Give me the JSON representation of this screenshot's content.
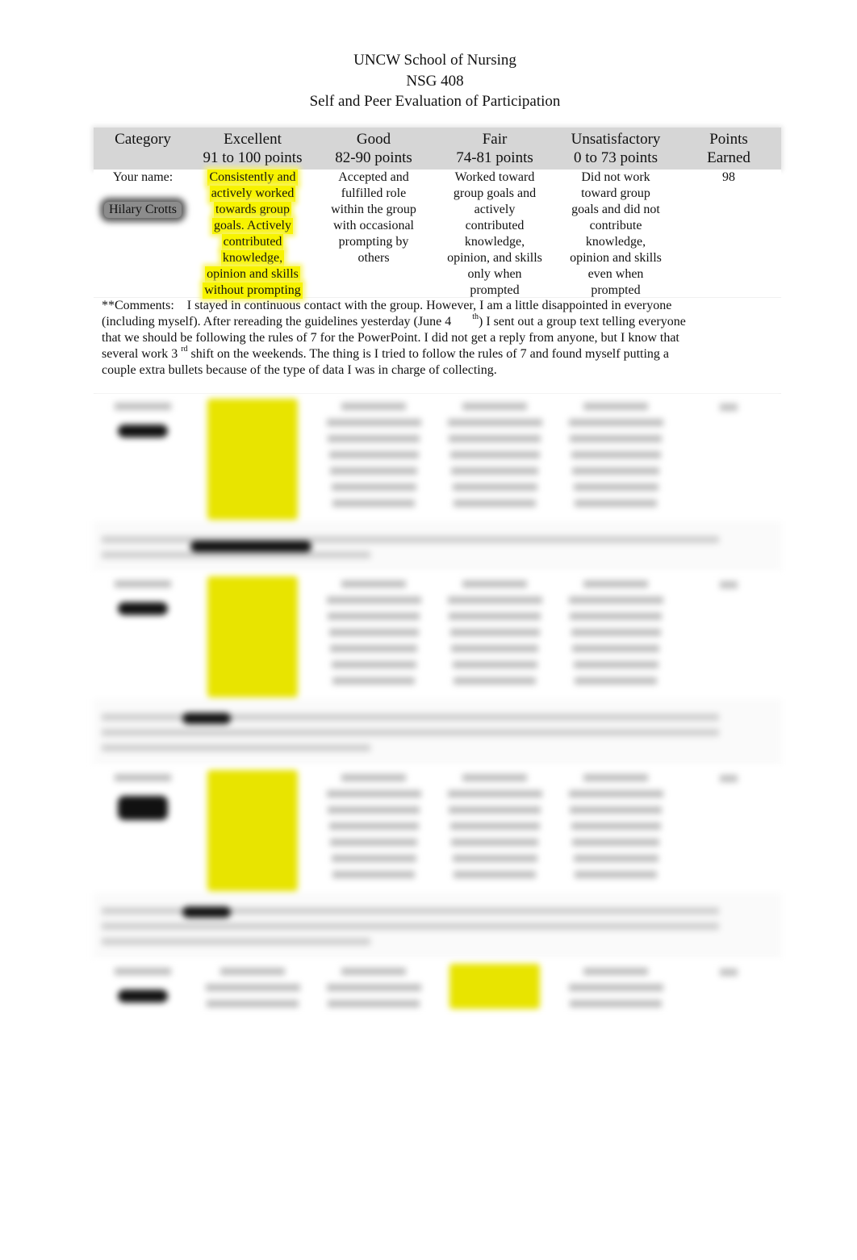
{
  "document": {
    "title_lines": [
      "UNCW School of Nursing",
      "NSG 408",
      "Self and Peer Evaluation of Participation"
    ]
  },
  "table": {
    "headers": [
      {
        "label": "Category",
        "sub": ""
      },
      {
        "label": "Excellent",
        "sub": "91 to 100 points"
      },
      {
        "label": "Good",
        "sub": "82-90 points"
      },
      {
        "label": "Fair",
        "sub": "74-81 points"
      },
      {
        "label": "Unsatisfactory",
        "sub": "0 to 73 points"
      },
      {
        "label": "Points",
        "sub": "Earned"
      }
    ],
    "self_evaluation": {
      "name_label": "Your name:",
      "name": "Hilary Crotts",
      "selected_level": "Excellent",
      "highlight_color": "#f7f300",
      "criteria": {
        "excellent": [
          "Consistently and",
          "actively worked",
          "towards group",
          "goals.  Actively",
          "contributed",
          "knowledge,",
          "opinion and skills",
          "without prompting"
        ],
        "good": [
          "Accepted and",
          "fulfilled role",
          "within the group",
          "with occasional",
          "prompting by",
          "others"
        ],
        "fair": [
          "Worked toward",
          "group goals and",
          "actively",
          "contributed",
          "knowledge,",
          "opinion, and skills",
          "only when",
          "prompted"
        ],
        "unsatisfactory": [
          "Did not work",
          "toward group",
          "goals and did not",
          "contribute",
          "knowledge,",
          "opinion and skills",
          "even when",
          "prompted"
        ]
      },
      "points": "98",
      "comments_label": "**Comments:",
      "comments_lines": [
        "I stayed in continuous contact with the group. However, I am a little disappointed in everyone",
        "(including myself). After rereading the guidelines yesterday (June 4",
        ") I sent out a group text telling everyone",
        "that we should be following the rules of 7 for the PowerPoint. I did not get a reply from anyone, but I know that",
        "several work 3",
        " shift on the weekends. The thing is I tried to follow the rules of 7 and found myself putting a",
        "couple extra bullets because of the type of data I was in charge of collecting."
      ],
      "sup_th": "th",
      "sup_rd": "rd"
    },
    "peer_evaluations_obscured": [
      {
        "selected_level": "Excellent"
      },
      {
        "selected_level": "Excellent"
      },
      {
        "selected_level": "Excellent"
      },
      {
        "selected_level": "Fair"
      }
    ]
  }
}
